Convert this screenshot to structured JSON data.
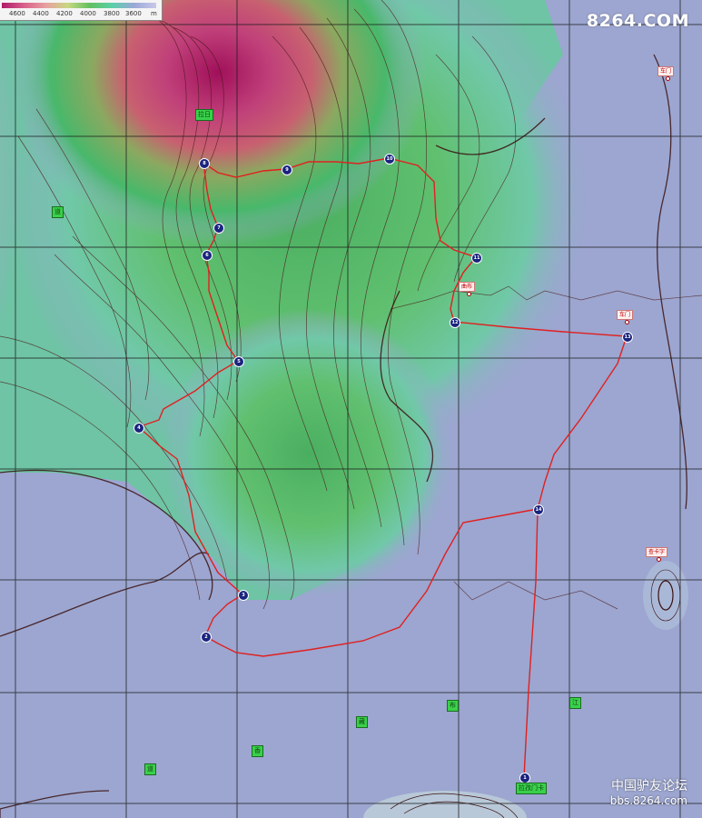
{
  "legend": {
    "ticks": [
      "4600",
      "4400",
      "4200",
      "4000",
      "3800",
      "3600"
    ],
    "unit": "m"
  },
  "watermarks": {
    "top": "8264.COM",
    "bottom_cn": "中国驴友论坛",
    "bottom_url": "bbs.8264.com"
  },
  "colors": {
    "route": "#e02020",
    "waypoint": "#1a237e",
    "grid": "#202020",
    "contour": "#5a1a1a"
  },
  "waypoints": [
    {
      "id": "p1",
      "label": "1"
    },
    {
      "id": "p2",
      "label": "2"
    },
    {
      "id": "p3",
      "label": "3"
    },
    {
      "id": "p4",
      "label": "4"
    },
    {
      "id": "p5",
      "label": "5"
    },
    {
      "id": "p6",
      "label": "6"
    },
    {
      "id": "p7",
      "label": "7"
    },
    {
      "id": "p8",
      "label": "8"
    },
    {
      "id": "p9",
      "label": "9"
    },
    {
      "id": "p10",
      "label": "10"
    },
    {
      "id": "p11",
      "label": "11"
    },
    {
      "id": "p12",
      "label": "12"
    },
    {
      "id": "p13",
      "label": "13"
    },
    {
      "id": "p14",
      "label": "14"
    }
  ],
  "labels": {
    "summit": "拉日",
    "bottom": "拉孜门卡",
    "left_char": "道",
    "c1": "道",
    "c2": "香",
    "c3": "藏",
    "c4": "布",
    "c5": "江"
  },
  "red_labels": {
    "chemen_top": "车门",
    "qubu": "曲布",
    "chemen_mid": "车门",
    "chakazi": "查卡字"
  }
}
